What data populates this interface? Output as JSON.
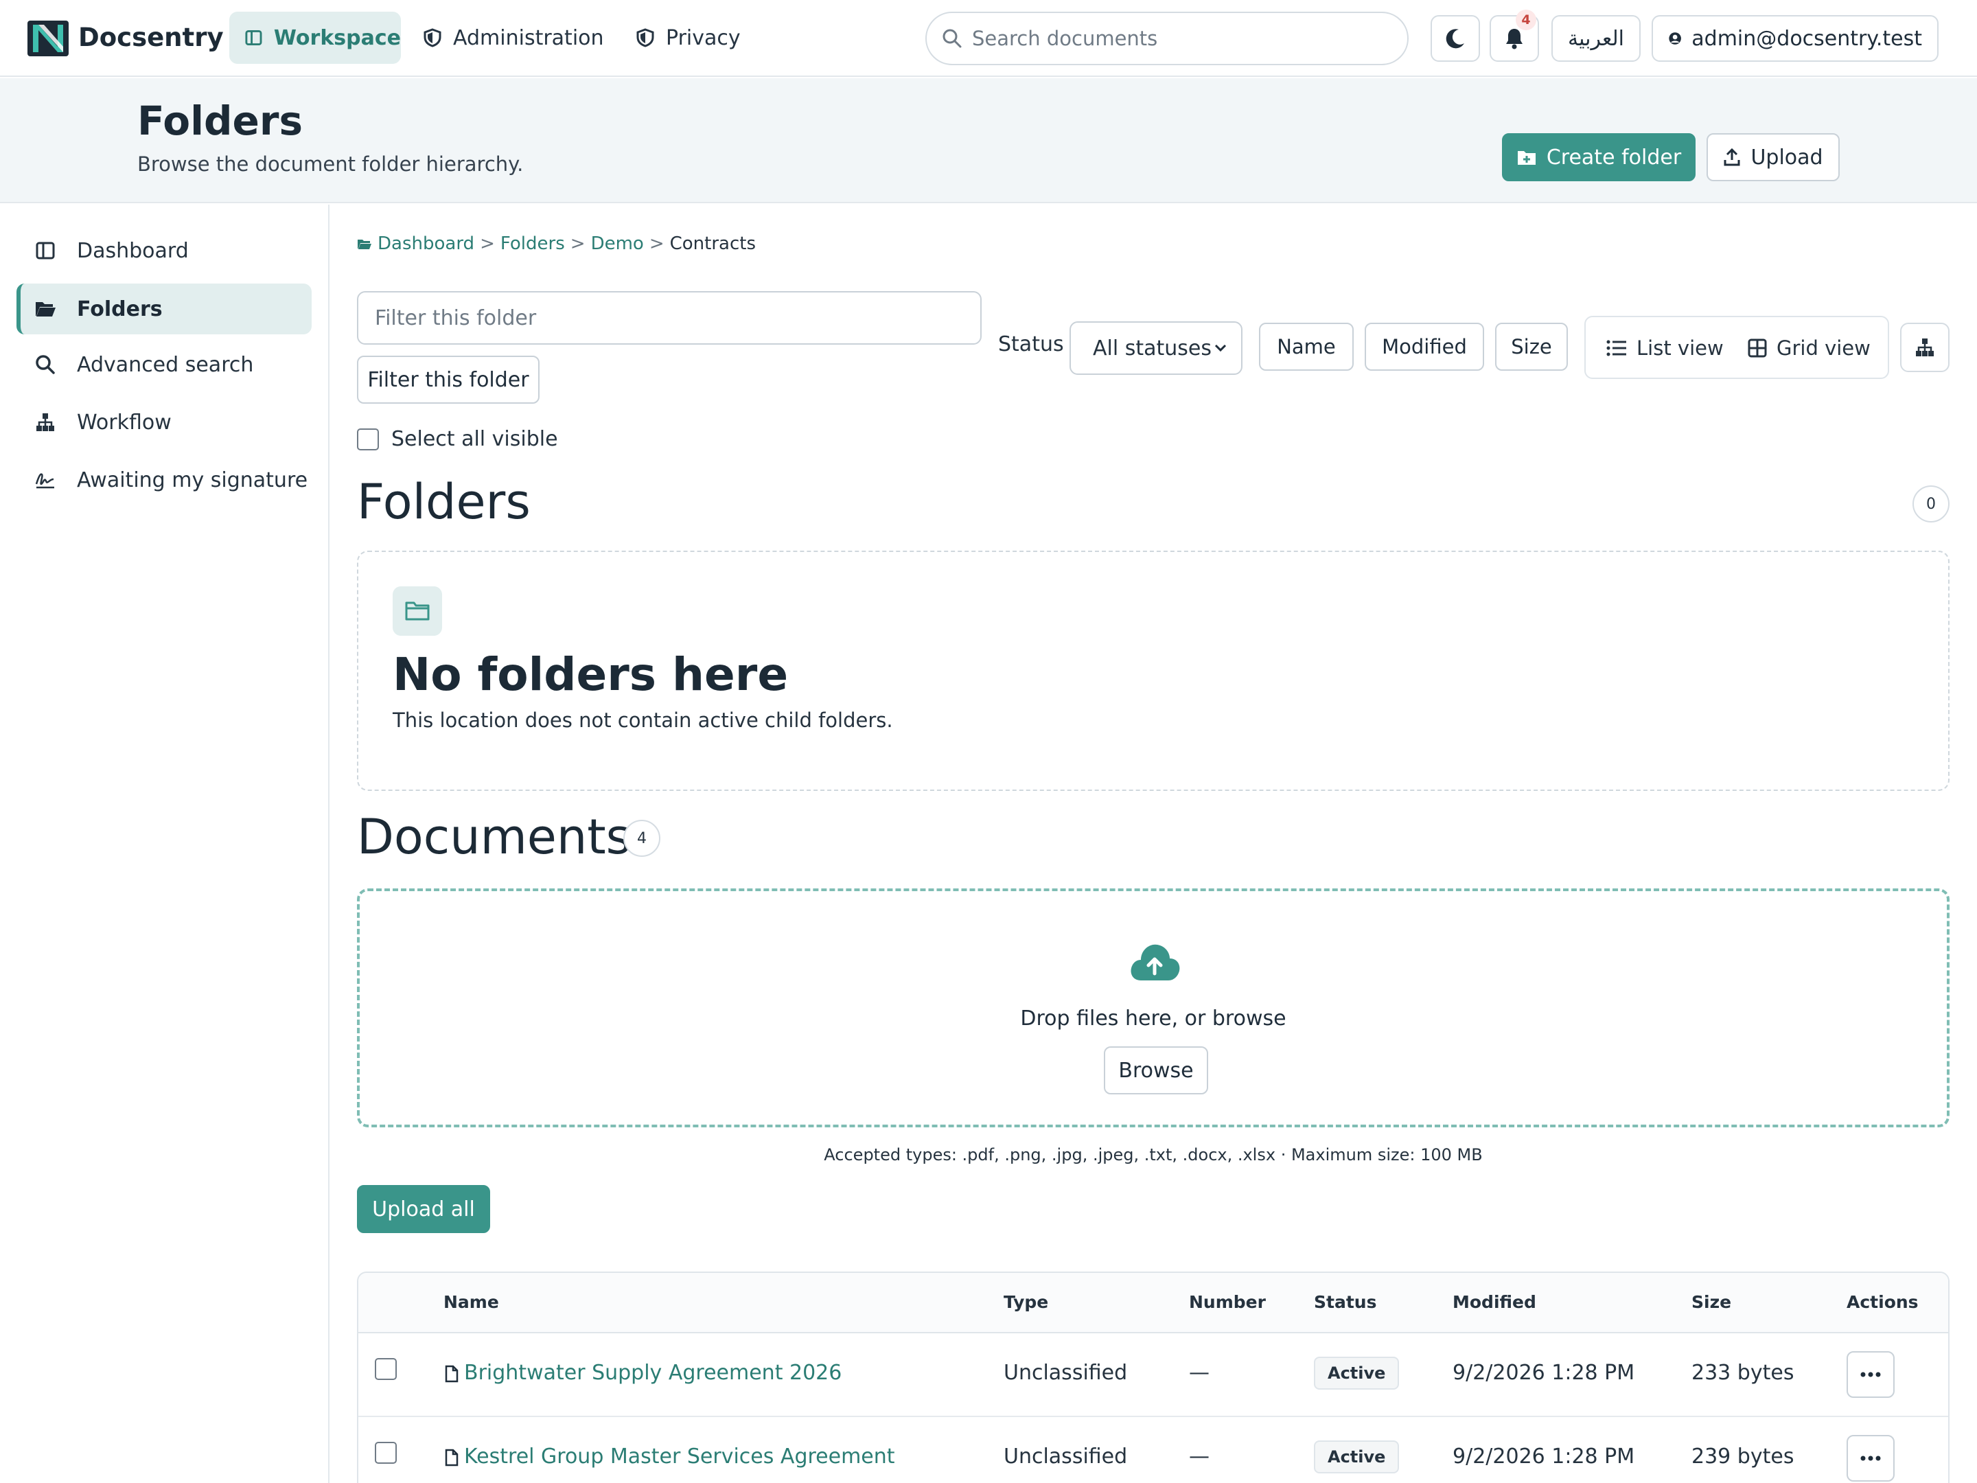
{
  "app": {
    "name": "Docsentry"
  },
  "nav": {
    "tabs": [
      {
        "label": "Workspace",
        "icon": "layout-icon",
        "active": true
      },
      {
        "label": "Administration",
        "icon": "shield-icon",
        "active": false
      },
      {
        "label": "Privacy",
        "icon": "shield-half-icon",
        "active": false
      }
    ],
    "search_placeholder": "Search documents",
    "notification_count": "4",
    "language_label": "العربية",
    "user_email": "admin@docsentry.test"
  },
  "header": {
    "title": "Folders",
    "subtitle": "Browse the document folder hierarchy.",
    "create_folder_label": "Create folder",
    "upload_label": "Upload"
  },
  "sidebar": {
    "items": [
      {
        "label": "Dashboard",
        "icon": "layout-icon",
        "active": false
      },
      {
        "label": "Folders",
        "icon": "folder-open-icon",
        "active": true
      },
      {
        "label": "Advanced search",
        "icon": "search-icon",
        "active": false
      },
      {
        "label": "Workflow",
        "icon": "sitemap-icon",
        "active": false
      },
      {
        "label": "Awaiting my signature",
        "icon": "signature-icon",
        "active": false
      }
    ]
  },
  "breadcrumb": {
    "items": [
      "Dashboard",
      "Folders",
      "Demo"
    ],
    "current": "Contracts"
  },
  "toolbar": {
    "filter_placeholder": "Filter this folder",
    "filter_button_label": "Filter this folder",
    "status_label": "Status",
    "status_value": "All statuses",
    "sort_buttons": [
      "Name",
      "Modified",
      "Size"
    ],
    "list_view_label": "List view",
    "grid_view_label": "Grid view",
    "select_all_label": "Select all visible"
  },
  "folders_section": {
    "title": "Folders",
    "count": "0",
    "empty_title": "No folders here",
    "empty_text": "This location does not contain active child folders."
  },
  "documents_section": {
    "title": "Documents",
    "count": "4",
    "drop_text": "Drop files here, or browse",
    "browse_label": "Browse",
    "accepted_text": "Accepted types: .pdf, .png, .jpg, .jpeg, .txt, .docx, .xlsx · Maximum size: 100 MB",
    "upload_all_label": "Upload all"
  },
  "table": {
    "columns": [
      "Name",
      "Type",
      "Number",
      "Status",
      "Modified",
      "Size",
      "Actions"
    ],
    "rows": [
      {
        "name": "Brightwater Supply Agreement 2026",
        "type": "Unclassified",
        "number": "—",
        "status": "Active",
        "modified": "9/2/2026 1:28 PM",
        "size": "233 bytes"
      },
      {
        "name": "Kestrel Group Master Services Agreement",
        "type": "Unclassified",
        "number": "—",
        "status": "Active",
        "modified": "9/2/2026 1:28 PM",
        "size": "239 bytes"
      }
    ]
  },
  "colors": {
    "accent": "#3a958a",
    "accent_text": "#2b7d74",
    "active_bg": "#e2eeee",
    "badge_red": "#c6453e"
  }
}
